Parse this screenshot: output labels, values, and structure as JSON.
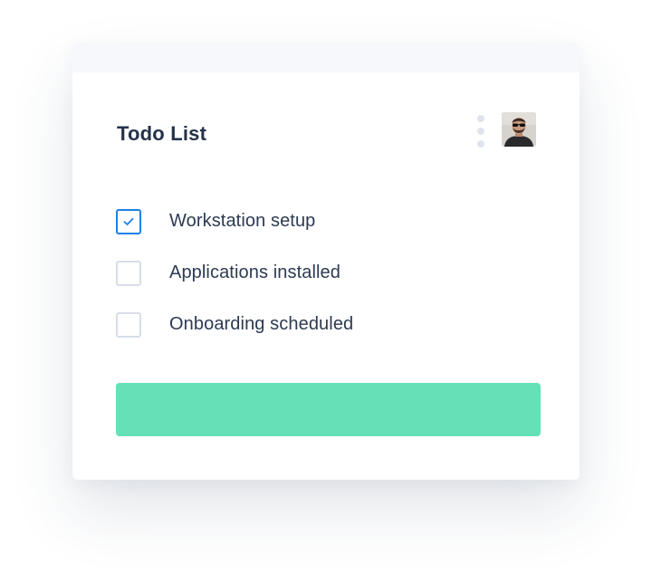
{
  "card": {
    "title": "Todo List",
    "icons": {
      "menu": "more-vertical-icon",
      "avatar": "user-avatar"
    },
    "todos": [
      {
        "label": "Workstation setup",
        "checked": true
      },
      {
        "label": "Applications installed",
        "checked": false
      },
      {
        "label": "Onboarding scheduled",
        "checked": false
      }
    ],
    "submit_label": ""
  },
  "colors": {
    "accent_blue": "#1f80e5",
    "button_green": "#64e1b7",
    "title_text": "#25324a",
    "item_text": "#2c3a52",
    "checkbox_border": "#d8dee8",
    "kebab_dots": "#dfe4ec"
  }
}
